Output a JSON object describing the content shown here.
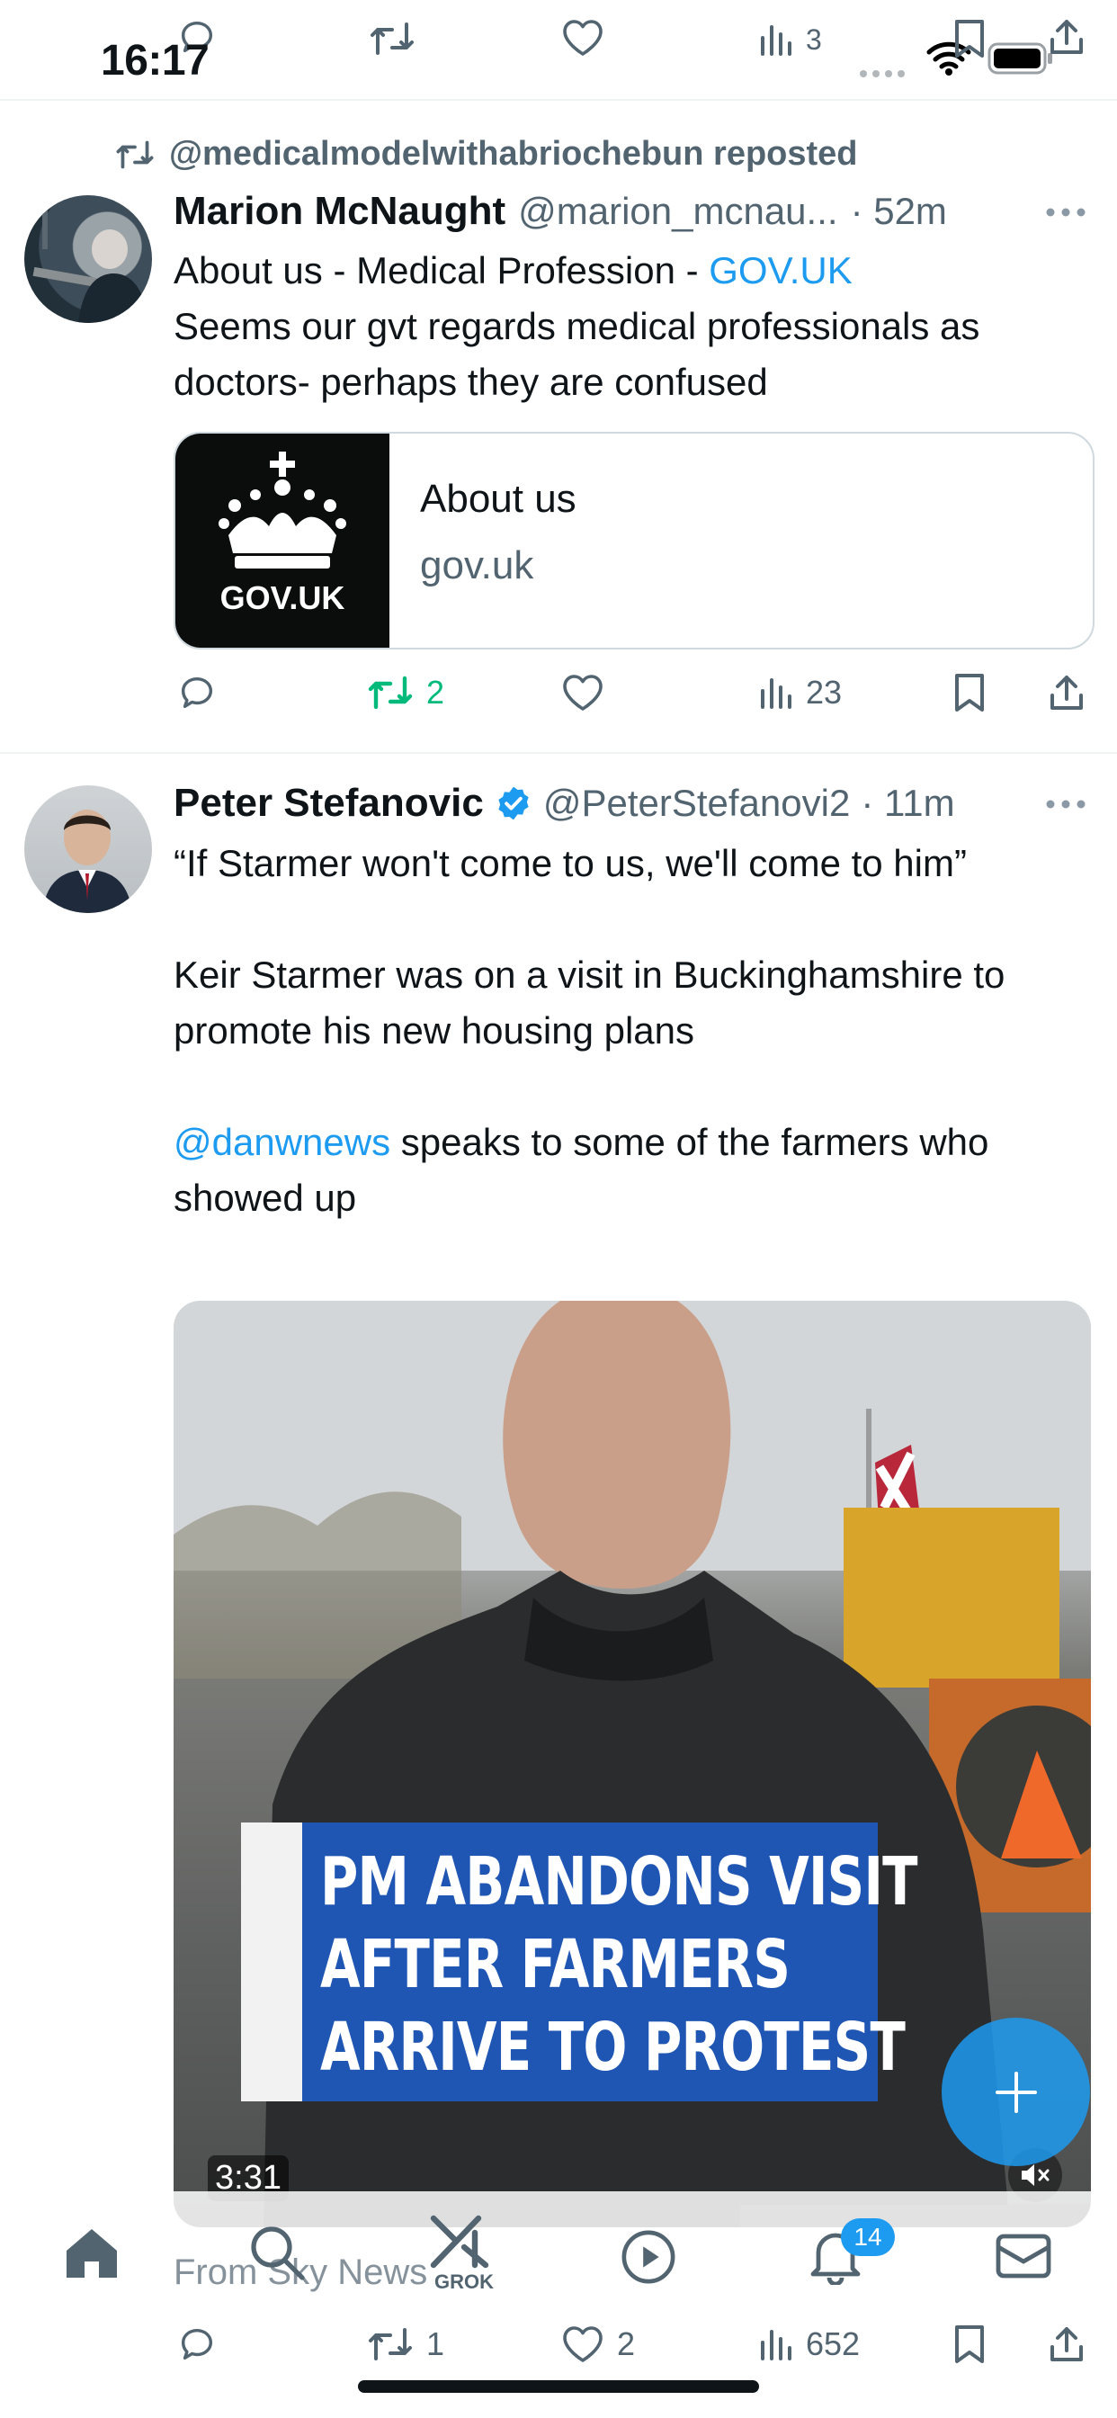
{
  "status_bar": {
    "time": "16:17"
  },
  "top_actions": {
    "views": "3"
  },
  "tweet1": {
    "repost_label": "@medicalmodelwithabriochebun reposted",
    "author_name": "Marion McNaught",
    "handle": "@marion_mcnau...",
    "time": "· 52m",
    "text_prefix": "About us - Medical Profession - ",
    "text_link": "GOV.UK",
    "text_rest": "Seems our gvt regards medical professionals as doctors- perhaps they are confused",
    "card": {
      "thumb_label": "GOV.UK",
      "title": "About us",
      "domain": "gov.uk"
    },
    "actions": {
      "reposts": "2",
      "views": "23"
    }
  },
  "tweet2": {
    "author_name": "Peter Stefanovic",
    "handle": "@PeterStefanovi2",
    "time": "· 11m",
    "para1": "“If Starmer won't come to us, we'll come to him”",
    "para2": "Keir Starmer was on a visit in Buckinghamshire to promote his new housing plans",
    "mention": "@danwnews",
    "para3_rest": " speaks to some of the farmers who showed up",
    "video": {
      "banner_lines": [
        "PM ABANDONS VISIT",
        "AFTER FARMERS",
        "ARRIVE TO PROTEST"
      ],
      "duration": "3:31"
    },
    "source": "From Sky News",
    "actions": {
      "reposts": "1",
      "likes": "2",
      "views": "652"
    }
  },
  "nav": {
    "grok_label": "GROK",
    "notifications_badge": "14"
  },
  "colors": {
    "accent": "#1d9bf0",
    "repost_green": "#00ba7c",
    "text_gray": "#536471"
  }
}
